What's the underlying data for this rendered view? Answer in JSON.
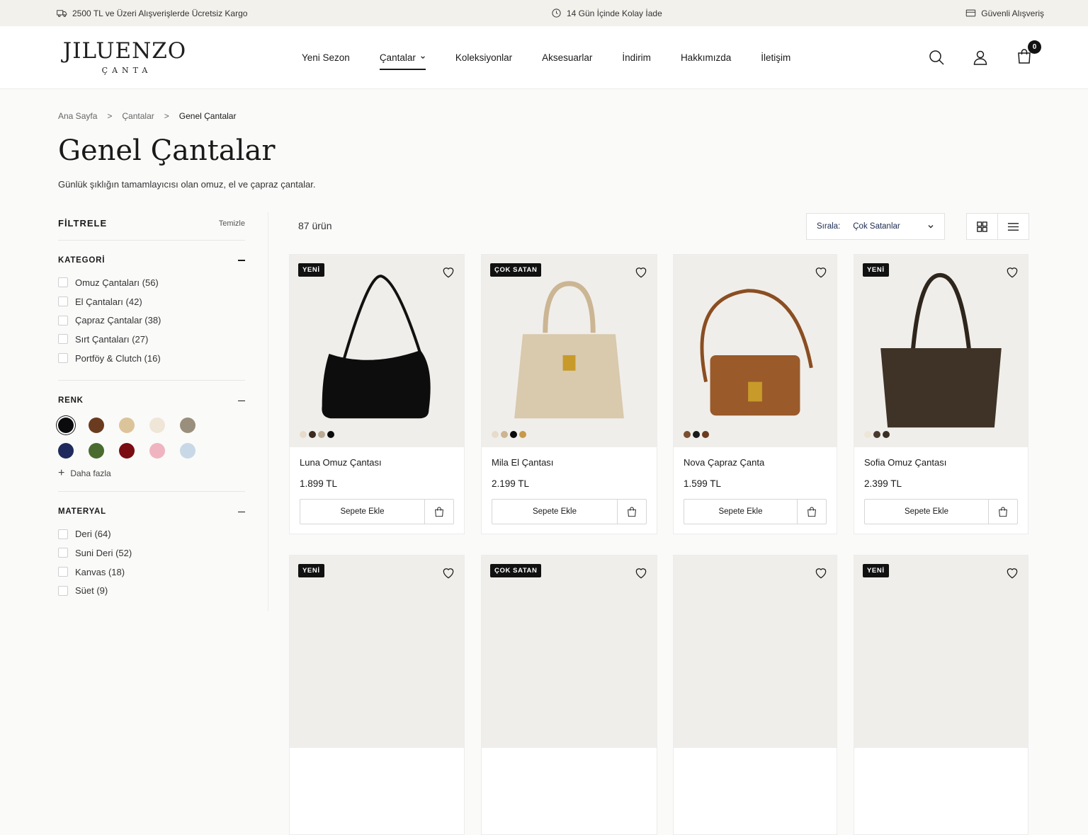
{
  "topbar": {
    "shipping": "2500 TL ve Üzeri Alışverişlerde Ücretsiz Kargo",
    "returns": "14 Gün İçinde Kolay İade",
    "secure": "Güvenli Alışveriş"
  },
  "brand": {
    "name": "JILUENZO",
    "sub": "ÇANTA"
  },
  "nav": [
    "Yeni Sezon",
    "Çantalar",
    "Koleksiyonlar",
    "Aksesuarlar",
    "İndirim",
    "Hakkımızda",
    "İletişim"
  ],
  "cart_count": "0",
  "breadcrumb": {
    "home": "Ana Sayfa",
    "sep": ">",
    "parent": "Çantalar",
    "current": "Genel Çantalar"
  },
  "page": {
    "title": "Genel Çantalar",
    "description": "Günlük şıklığın tamamlayıcısı olan omuz, el ve çapraz çantalar."
  },
  "filters": {
    "title": "FİLTRELE",
    "clear": "Temizle",
    "category": {
      "title": "KATEGORİ",
      "items": [
        "Omuz Çantaları (56)",
        "El Çantaları (42)",
        "Çapraz Çantalar (38)",
        "Sırt Çantaları (27)",
        "Portföy & Clutch (16)"
      ]
    },
    "color": {
      "title": "RENK",
      "swatches": [
        "#0b0b0d",
        "#6b3b1f",
        "#dcc49a",
        "#efe6d8",
        "#9a8f7c",
        "#1f2b5c",
        "#4a6b2f",
        "#7a0c12",
        "#f0b4c0",
        "#c8d8e6"
      ],
      "more": "Daha fazla"
    },
    "material": {
      "title": "MATERYAL",
      "items": [
        "Deri (64)",
        "Suni Deri (52)",
        "Kanvas (18)",
        "Süet (9)"
      ]
    }
  },
  "toolbar": {
    "count": "87 ürün",
    "sort_label": "Sırala:",
    "sort_value": "Çok Satanlar"
  },
  "products": [
    {
      "tag": "YENİ",
      "name": "Luna Omuz Çantası",
      "price": "1.899 TL",
      "cta": "Sepete Ekle",
      "bag_color": "#0d0d0d",
      "colors": [
        "#e6dccb",
        "#3a2a20",
        "#b9aa94",
        "#0b0b0b"
      ]
    },
    {
      "tag": "ÇOK SATAN",
      "name": "Mila El Çantası",
      "price": "2.199 TL",
      "cta": "Sepete Ekle",
      "bag_color": "#d9c9ad",
      "colors": [
        "#e6dccb",
        "#cbb593",
        "#0b0b0b",
        "#c79a4a"
      ]
    },
    {
      "tag": "",
      "name": "Nova Çapraz Çanta",
      "price": "1.599 TL",
      "cta": "Sepete Ekle",
      "bag_color": "#9a5a2a",
      "colors": [
        "#7a5030",
        "#1a1a1a",
        "#6b3b1f"
      ]
    },
    {
      "tag": "YENİ",
      "name": "Sofia Omuz Çantası",
      "price": "2.399 TL",
      "cta": "Sepete Ekle",
      "bag_color": "#3e3326",
      "colors": [
        "#efe6d8",
        "#4a3a2c",
        "#3a2e24"
      ]
    },
    {
      "tag": "YENİ"
    },
    {
      "tag": "ÇOK SATAN"
    },
    {
      "tag": ""
    },
    {
      "tag": "YENİ"
    }
  ]
}
